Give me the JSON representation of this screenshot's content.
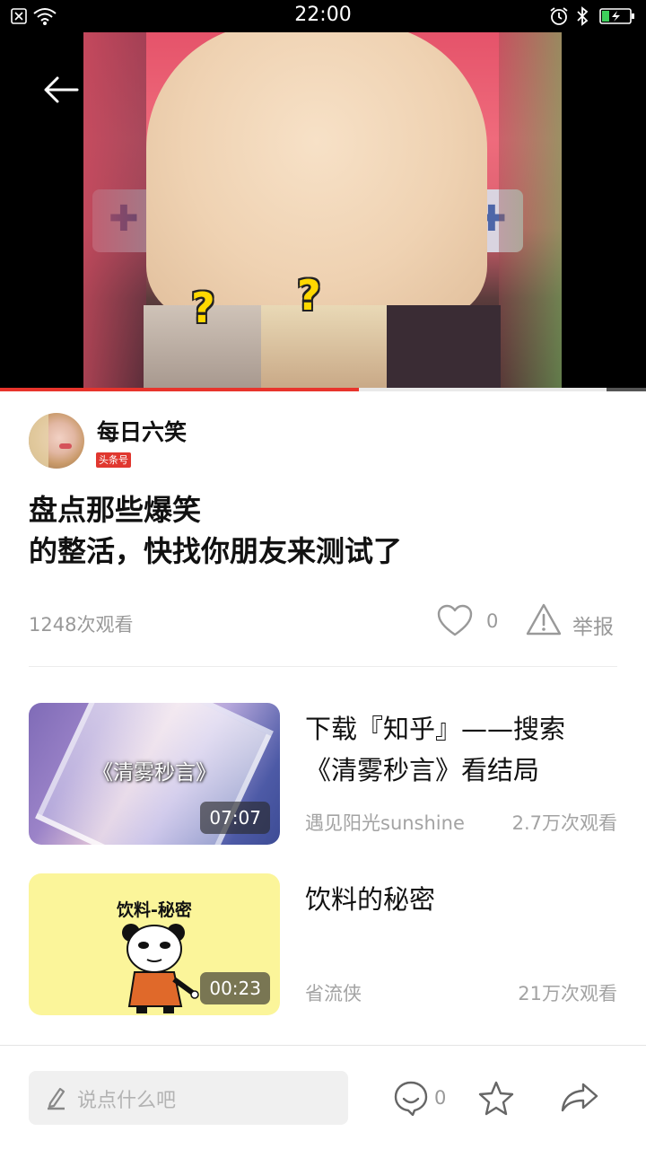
{
  "status_bar": {
    "time": "22:00",
    "icons": [
      "sim-none-icon",
      "wifi-icon",
      "alarm-icon",
      "bluetooth-icon",
      "battery-charging-icon"
    ]
  },
  "video": {
    "progress": 0.555,
    "icons": [
      "back-arrow-icon",
      "question-mark-overlay"
    ]
  },
  "author": {
    "name": "每日六笑",
    "badge": "头条号"
  },
  "title": {
    "line1": "盘点那些爆笑",
    "line2": "的整活，快找你朋友来测试了"
  },
  "stats": {
    "views": "1248次观看",
    "likes": "0",
    "report_label": "举报"
  },
  "recommended": [
    {
      "thumb_caption": "《清雾秒言》",
      "duration": "07:07",
      "title": "下载『知乎』——搜索《清雾秒言》看结局",
      "author": "遇见阳光sunshine",
      "views": "2.7万次观看"
    },
    {
      "thumb_caption": "饮料-秘密",
      "duration": "00:23",
      "title": "饮料的秘密",
      "author": "省流侠",
      "views": "21万次观看"
    }
  ],
  "bottom_bar": {
    "comment_placeholder": "说点什么吧",
    "comment_count": "0",
    "icons": [
      "pen-icon",
      "comment-icon",
      "star-icon",
      "share-icon"
    ]
  },
  "colors": {
    "accent": "#e8342c",
    "muted_text": "#999999"
  }
}
